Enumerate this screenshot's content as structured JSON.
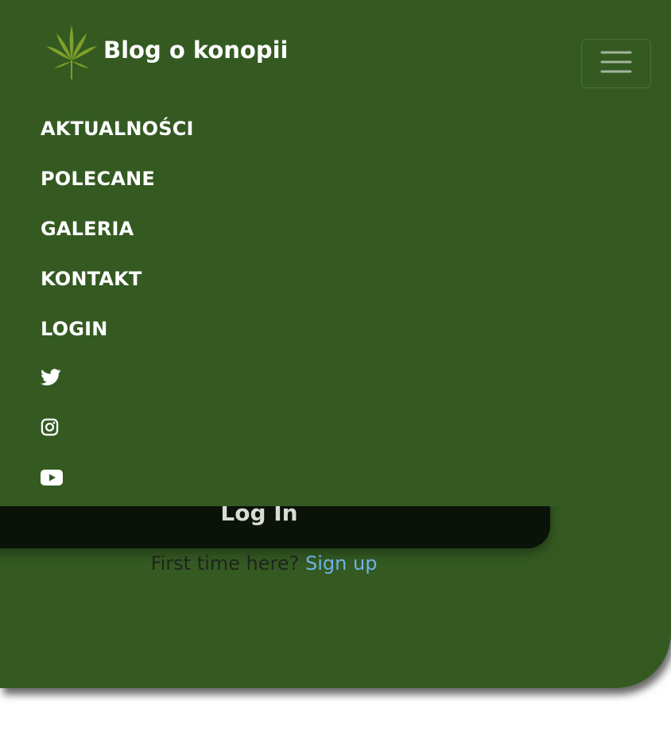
{
  "brand": {
    "title": "Blog o konopii",
    "logo_icon": "cannabis-leaf-icon"
  },
  "navbar": {
    "toggler_icon": "hamburger-menu-icon",
    "items": [
      {
        "label": "AKTUALNOŚCI"
      },
      {
        "label": "POLECANE"
      },
      {
        "label": "GALERIA"
      },
      {
        "label": "KONTAKT"
      },
      {
        "label": "LOGIN"
      }
    ],
    "social": [
      {
        "icon": "twitter-icon"
      },
      {
        "icon": "instagram-icon"
      },
      {
        "icon": "youtube-icon"
      }
    ]
  },
  "login_form": {
    "submit_label": "Log In",
    "signup_prompt": "First time here?",
    "signup_link": "Sign up"
  },
  "colors": {
    "background": "#345a22",
    "button": "#0b1309",
    "link": "#6fb1e6",
    "nav_text": "#ffffff"
  }
}
